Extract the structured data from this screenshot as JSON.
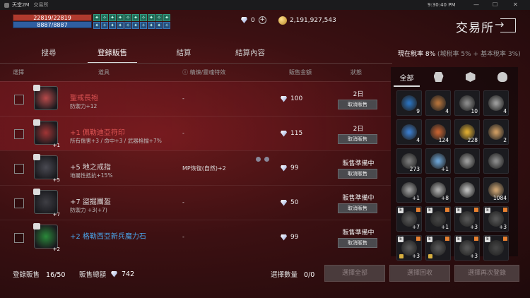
{
  "window": {
    "title": "天堂2M",
    "subtitle": "交易所",
    "clock": "9:30:40 PM",
    "min": "—",
    "max": "☐",
    "close": "✕"
  },
  "player": {
    "hp": "22819/22819",
    "mp": "8887/8887"
  },
  "buffs": [
    "✦",
    "✧",
    "✦",
    "✦",
    "✧",
    "✦",
    "✧",
    "✦",
    "✧",
    "✦",
    "✦",
    "✧",
    "✦",
    "✦",
    "✧",
    "✦",
    "✧",
    "✦",
    "✦",
    "✧"
  ],
  "currency": {
    "diamonds": "0",
    "adena": "2,191,927,543"
  },
  "header": {
    "title": "交易所"
  },
  "tabs": [
    "搜尋",
    "登錄販售",
    "結算",
    "結算內容"
  ],
  "tax": {
    "label": "現在稅率",
    "value": "8%",
    "detail": "(城稅率 5% + 基本稅率 3%)"
  },
  "columns": {
    "select": "選擇",
    "item": "道具",
    "effect": "精煉/靈魂特效",
    "price": "販售金額",
    "status": "狀態"
  },
  "rows": [
    {
      "name": "聖戒長袍",
      "name_color": "red",
      "stat": "防禦力+12",
      "effect": "-",
      "price": "100",
      "status": "2日",
      "button": "取消販售",
      "enchant": "",
      "icon_color": "#b84a4a"
    },
    {
      "name": "+1 佩勒迪亞符印",
      "name_color": "red",
      "stat": "所有傷害+3 / 命中+3 / 武器格擋+7%",
      "effect": "-",
      "price": "115",
      "status": "2日",
      "button": "取消販售",
      "enchant": "+1",
      "icon_color": "#a23535"
    },
    {
      "name": "+5 地之戒指",
      "name_color": "white",
      "stat": "地屬性抵抗+15%",
      "effect": "MP恢復(自然)+2",
      "price": "99",
      "status": "販售準備中",
      "button": "取消販售",
      "enchant": "+5",
      "icon_color": "#4a4a52"
    },
    {
      "name": "+7 盜掘團盔",
      "name_color": "white",
      "stat": "防禦力 +3(+7)",
      "effect": "-",
      "price": "50",
      "status": "販售準備中",
      "button": "取消販售",
      "enchant": "+7",
      "icon_color": "#3e3e44"
    },
    {
      "name": "+2 格勒西亞新兵魔力石",
      "name_color": "blue",
      "stat": "",
      "effect": "-",
      "price": "99",
      "status": "販售準備中",
      "button": "取消販售",
      "enchant": "+2",
      "icon_color": "#2a8a3a"
    }
  ],
  "inventory": {
    "tabs": [
      "全部",
      "helmet-icon",
      "cube-icon",
      "potion-icon"
    ],
    "tab_all": "全部",
    "slots": [
      {
        "c": "#2a6fb8",
        "n": "9"
      },
      {
        "c": "#b0703a",
        "n": "4"
      },
      {
        "c": "#888",
        "n": "10"
      },
      {
        "c": "#999",
        "n": "4"
      },
      {
        "c": "#3a7ac8",
        "n": "4"
      },
      {
        "c": "#c06030",
        "n": "124"
      },
      {
        "c": "#d8a830",
        "n": "228"
      },
      {
        "c": "#c89860",
        "n": "2"
      },
      {
        "c": "#777",
        "n": "273"
      },
      {
        "c": "#6aa0d0",
        "n": "+1"
      },
      {
        "c": "#999",
        "n": ""
      },
      {
        "c": "#888",
        "n": ""
      },
      {
        "c": "#999",
        "n": "+1"
      },
      {
        "c": "#aaa",
        "n": "+8"
      },
      {
        "c": "#bbb",
        "n": ""
      },
      {
        "c": "#c8a070",
        "n": "1084"
      },
      {
        "c": "#555",
        "n": "+7",
        "e": true
      },
      {
        "c": "#444",
        "n": "+1",
        "e": true
      },
      {
        "c": "#555",
        "n": "+3",
        "e": true
      },
      {
        "c": "#555",
        "n": "+3",
        "e": true
      },
      {
        "c": "#555",
        "n": "+3",
        "e": true
      },
      {
        "c": "#555",
        "n": "",
        "e": true
      },
      {
        "c": "#555",
        "n": "+3",
        "e": true
      },
      {
        "c": "#444",
        "n": "",
        "e": true
      }
    ]
  },
  "footer": {
    "listed_label": "登錄販售",
    "listed_value": "16/50",
    "total_label": "販售總額",
    "total_value": "742",
    "select_count_label": "選擇數量",
    "select_count_value": "0/0",
    "btn_select_all": "選擇全部",
    "btn_select_return": "選擇回收",
    "btn_select_relist": "選擇再次登錄"
  }
}
